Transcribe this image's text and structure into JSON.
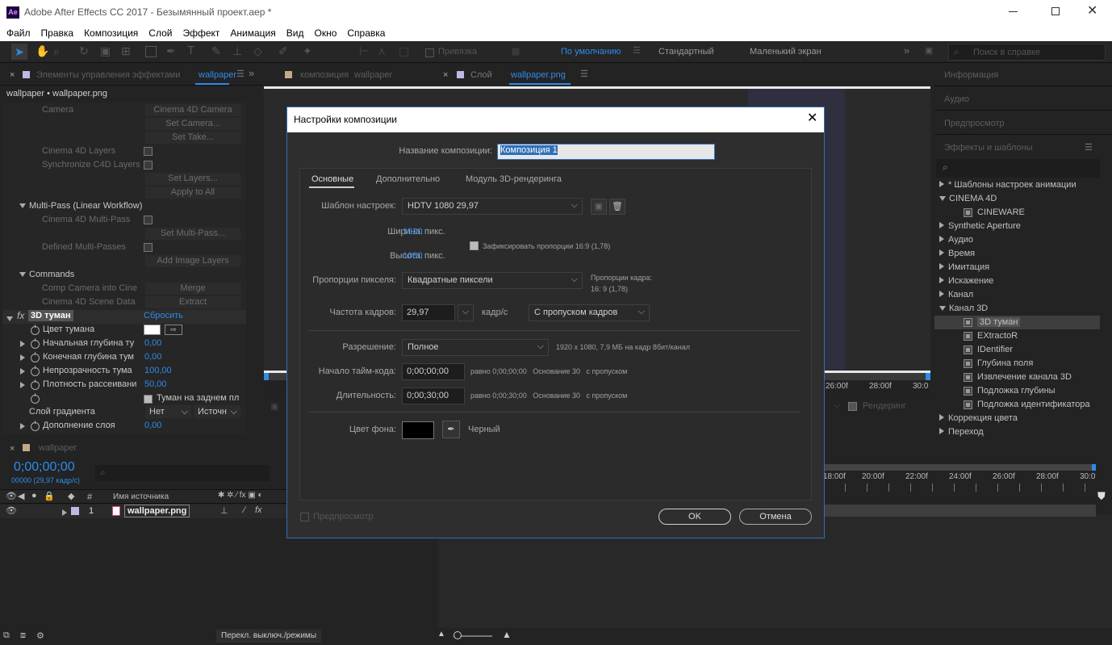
{
  "window": {
    "title": "Adobe After Effects CC 2017 - Безымянный проект.aep *",
    "app_badge": "Ae"
  },
  "menu": [
    "Файл",
    "Правка",
    "Композиция",
    "Слой",
    "Эффект",
    "Анимация",
    "Вид",
    "Окно",
    "Справка"
  ],
  "toolbar": {
    "snap_label": "Привязка",
    "workspaces": [
      "По умолчанию",
      "Стандартный",
      "Маленький экран"
    ],
    "search_placeholder": "Поиск в справке"
  },
  "effects_panel": {
    "tab_label": "Элементы управления эффектами",
    "tab_layer": "wallpaper",
    "header": "wallpaper • wallpaper.png",
    "rows": {
      "camera": "Camera",
      "camera_val": "Cinema 4D Camera",
      "set_camera": "Set Camera...",
      "set_take": "Set Take...",
      "c4d_layers": "Cinema 4D Layers",
      "sync_layers": "Synchronize C4D Layers",
      "set_layers": "Set Layers...",
      "apply_all": "Apply to All",
      "multipass": "Multi-Pass (Linear Workflow)",
      "c4d_multipass": "Cinema 4D Multi-Pass",
      "set_multipass": "Set Multi-Pass...",
      "defined_mp": "Defined Multi-Passes",
      "add_image": "Add Image Layers",
      "commands": "Commands",
      "comp_camera": "Comp Camera into Cine",
      "merge": "Merge",
      "scene_data": "Cinema 4D Scene Data",
      "extract": "Extract"
    },
    "fog": {
      "name": "3D туман",
      "reset": "Сбросить",
      "color": "Цвет тумана",
      "start": "Начальная глубина ту",
      "start_val": "0,00",
      "end": "Конечная глубина тум",
      "end_val": "0,00",
      "opacity": "Непрозрачность тума",
      "opacity_val": "100,00",
      "density": "Плотность рассеивани",
      "density_val": "50,00",
      "back_fog": "Туман на заднем пл",
      "gradient": "Слой градиента",
      "gradient_none": "Нет",
      "gradient_src": "Источн",
      "blend": "Дополнение слоя",
      "blend_val": "0,00"
    }
  },
  "comp_tabs": {
    "comp": "композиция",
    "comp_name": "wallpaper",
    "layer": "Слой",
    "layer_name": "wallpaper.png"
  },
  "viewer": {
    "ticks": [
      "26:00f",
      "28:00f",
      "30:0"
    ],
    "render_label": "Рендеринг"
  },
  "right_panel": {
    "sections": [
      "Информация",
      "Аудио",
      "Предпросмотр",
      "Эффекты и шаблоны"
    ],
    "tree": [
      {
        "label": "* Шаблоны настроек анимации",
        "type": "closed",
        "indent": 0
      },
      {
        "label": "CINEMA 4D",
        "type": "open",
        "indent": 0
      },
      {
        "label": "CINEWARE",
        "type": "effect",
        "indent": 1
      },
      {
        "label": "Synthetic Aperture",
        "type": "closed",
        "indent": 0
      },
      {
        "label": "Аудио",
        "type": "closed",
        "indent": 0
      },
      {
        "label": "Время",
        "type": "closed",
        "indent": 0
      },
      {
        "label": "Имитация",
        "type": "closed",
        "indent": 0
      },
      {
        "label": "Искажение",
        "type": "closed",
        "indent": 0
      },
      {
        "label": "Канал",
        "type": "closed",
        "indent": 0
      },
      {
        "label": "Канал 3D",
        "type": "open",
        "indent": 0
      },
      {
        "label": "3D туман",
        "type": "effect",
        "indent": 1,
        "selected": true
      },
      {
        "label": "EXtractoR",
        "type": "effect",
        "indent": 1
      },
      {
        "label": "IDentifier",
        "type": "effect",
        "indent": 1
      },
      {
        "label": "Глубина поля",
        "type": "effect",
        "indent": 1
      },
      {
        "label": "Извлечение канала 3D",
        "type": "effect",
        "indent": 1
      },
      {
        "label": "Подложка глубины",
        "type": "effect",
        "indent": 1
      },
      {
        "label": "Подложка идентификатора",
        "type": "effect",
        "indent": 1
      },
      {
        "label": "Коррекция цвета",
        "type": "closed",
        "indent": 0
      },
      {
        "label": "Переход",
        "type": "closed",
        "indent": 0
      }
    ]
  },
  "timeline": {
    "tab": "wallpaper",
    "timecode": "0;00;00;00",
    "frame_info": "00000 (29,97 кадр/с)",
    "col_num": "#",
    "col_source": "Имя источника",
    "layer_num": "1",
    "layer_name": "wallpaper.png",
    "ticks": [
      "18:00f",
      "20:00f",
      "22:00f",
      "24:00f",
      "26:00f",
      "28:00f",
      "30:0"
    ],
    "toggle_label": "Перекл. выключ./режимы"
  },
  "dialog": {
    "title": "Настройки композиции",
    "name_label": "Название композиции:",
    "name_value": "Композиция 1",
    "tabs": [
      "Основные",
      "Дополнительно",
      "Модуль 3D-рендеринга"
    ],
    "preset_label": "Шаблон настроек:",
    "preset_value": "HDTV 1080 29,97",
    "width_label": "Ширина:",
    "width_value": "1920",
    "width_unit": "пикс.",
    "height_label": "Высота:",
    "height_value": "1080",
    "height_unit": "пикс.",
    "lock_label": "Зафиксировать пропорции 16:9 (1,78)",
    "pixel_label": "Пропорции пикселя:",
    "pixel_value": "Квадратные пиксели",
    "frame_aspect_label": "Пропорции кадра:",
    "frame_aspect_value": "16: 9 (1,78)",
    "fps_label": "Частота кадров:",
    "fps_value": "29,97",
    "fps_unit": "кадр/с",
    "drop_value": "С пропуском кадров",
    "res_label": "Разрешение:",
    "res_value": "Полное",
    "res_info": "1920 x 1080, 7,9 МБ на кадр 8бит/канал",
    "start_label": "Начало тайм-кода:",
    "start_value": "0;00;00;00",
    "start_info": "равно 0;00;00;00   Основание 30   с пропуском",
    "dur_label": "Длительность:",
    "dur_value": "0;00;30;00",
    "dur_info": "равно 0;00;30;00   Основание 30   с пропуском",
    "bg_label": "Цвет фона:",
    "bg_color": "#000000",
    "bg_name": "Черный",
    "preview_label": "Предпросмотр",
    "ok": "OK",
    "cancel": "Отмена"
  },
  "colors": {
    "accent": "#2d8ceb",
    "dialog_border": "#2f6fb8",
    "selected_effect": "#3e3e3e"
  }
}
